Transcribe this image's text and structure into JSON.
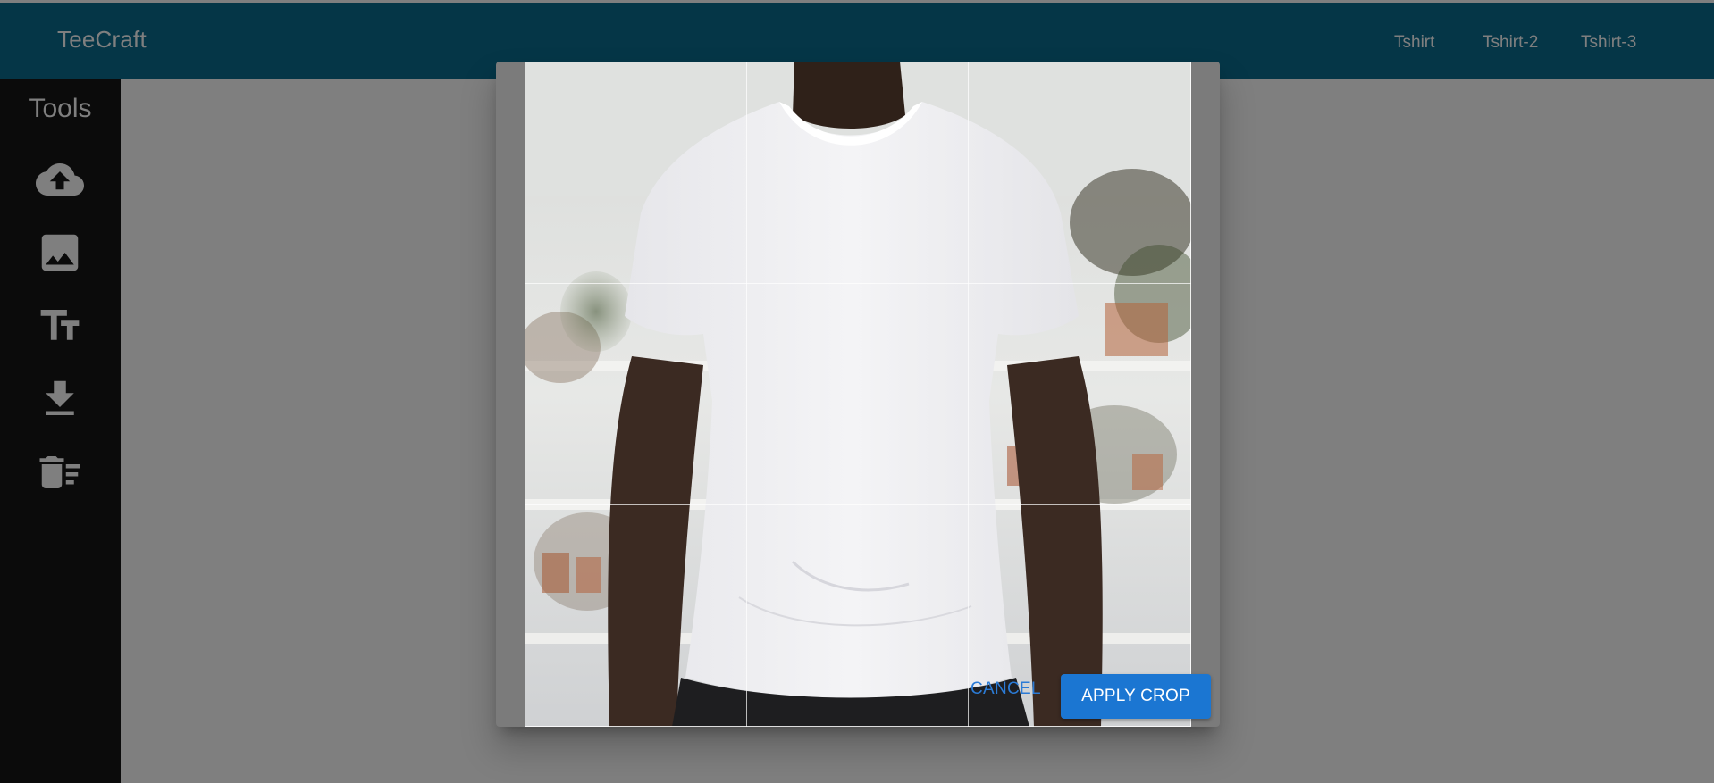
{
  "app": {
    "brand": "TeeCraft",
    "accent_color": "#0a6d8e"
  },
  "nav": {
    "links": [
      "Tshirt",
      "Tshirt-2",
      "Tshirt-3"
    ]
  },
  "drawer": {
    "title": "Tools",
    "tools": [
      {
        "icon": "cloud-upload-icon"
      },
      {
        "icon": "image-icon"
      },
      {
        "icon": "text-fields-icon"
      },
      {
        "icon": "download-icon"
      },
      {
        "icon": "clear-all-icon"
      }
    ]
  },
  "crop_dialog": {
    "cancel_label": "CANCEL",
    "apply_label": "APPLY CROP",
    "apply_color": "#1b76d2",
    "grid": "3x3"
  }
}
